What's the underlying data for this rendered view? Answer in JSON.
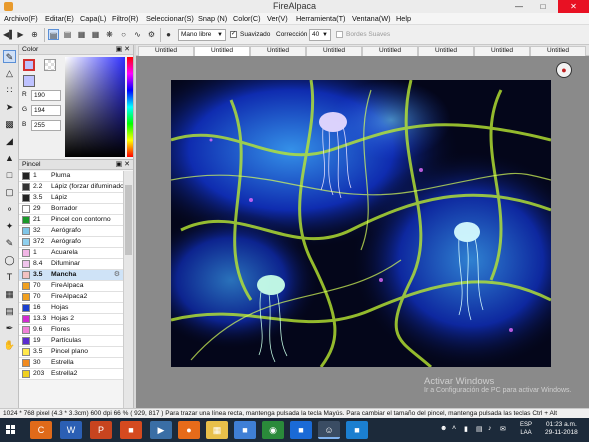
{
  "window": {
    "title": "FireAlpaca"
  },
  "menu": [
    "Archivo(F)",
    "Editar(E)",
    "Capa(L)",
    "Filtro(R)",
    "Seleccionar(S)",
    "Snap (N)",
    "Color(C)",
    "Ver(V)",
    "Herramienta(T)",
    "Ventana(W)",
    "Help"
  ],
  "toolbar": {
    "brush_mode": "Mano libre",
    "smoothing_label": "Suavizado",
    "smoothing_checked": true,
    "correction_label": "Corrección",
    "correction_value": "40",
    "edges_label": "Bordes Suaves",
    "edges_checked": false
  },
  "color_panel": {
    "title": "Color",
    "foreground": "#bec2ff",
    "r_label": "R",
    "g_label": "G",
    "b_label": "B",
    "r": "190",
    "g": "194",
    "b": "255"
  },
  "brush_panel": {
    "title": "Pincel",
    "brushes": [
      {
        "size": "1",
        "name": "Pluma",
        "swatch": "#222222"
      },
      {
        "size": "2.2",
        "name": "Lápiz (forzar difuminado)",
        "swatch": "#333333"
      },
      {
        "size": "3.5",
        "name": "Lápiz",
        "swatch": "#222222"
      },
      {
        "size": "29",
        "name": "Borrador",
        "swatch": "#ffffff"
      },
      {
        "size": "21",
        "name": "Pincel con contorno",
        "swatch": "#1a9a2a"
      },
      {
        "size": "32",
        "name": "Aerógrafo",
        "swatch": "#7fc6e8"
      },
      {
        "size": "372",
        "name": "Aerógrafo",
        "swatch": "#8fd0ee"
      },
      {
        "size": "1",
        "name": "Acuarela",
        "swatch": "#f2b6e6"
      },
      {
        "size": "8.4",
        "name": "Difuminar",
        "swatch": "#f0c4ec"
      },
      {
        "size": "3.5",
        "name": "Mancha",
        "swatch": "#f3c2c2",
        "selected": true
      },
      {
        "size": "70",
        "name": "FireAlpaca",
        "swatch": "#f0a020"
      },
      {
        "size": "70",
        "name": "FireAlpaca2",
        "swatch": "#f0a020"
      },
      {
        "size": "16",
        "name": "Hojas",
        "swatch": "#1a3fcf"
      },
      {
        "size": "13.3",
        "name": "Hojas 2",
        "swatch": "#d22bd2"
      },
      {
        "size": "9.6",
        "name": "Flores",
        "swatch": "#f080d8"
      },
      {
        "size": "19",
        "name": "Partículas",
        "swatch": "#5b2bcf"
      },
      {
        "size": "3.5",
        "name": "Pincel plano",
        "swatch": "#ffe84a"
      },
      {
        "size": "30",
        "name": "Estrella",
        "swatch": "#f08a20"
      },
      {
        "size": "203",
        "name": "Estrella2",
        "swatch": "#f0d020"
      }
    ]
  },
  "tabs": [
    {
      "label": "Untitled",
      "active": false
    },
    {
      "label": "Untitled",
      "active": true
    },
    {
      "label": "Untitled",
      "active": false
    },
    {
      "label": "Untitled",
      "active": false
    },
    {
      "label": "Untitled",
      "active": false
    },
    {
      "label": "Untitled",
      "active": false
    },
    {
      "label": "Untitled",
      "active": false
    },
    {
      "label": "Untitled",
      "active": false
    }
  ],
  "watermark": {
    "title": "Activar Windows",
    "subtitle": "Ir a Configuración de PC para activar Windows."
  },
  "status": {
    "text": "1024 * 768 pixel  (4.3 * 3.3cm)  600 dpi  66 %  ( 929, 817 )  Para trazar una línea recta, mantenga pulsada la tecla Mayús. Para cambiar el tamaño del pincel, mantenga pulsada las teclas Ctrl + Alt"
  },
  "taskbar": {
    "language_top": "ESP",
    "language_bottom": "LAA",
    "time": "01:23 a.m.",
    "date": "29-11-2018"
  }
}
